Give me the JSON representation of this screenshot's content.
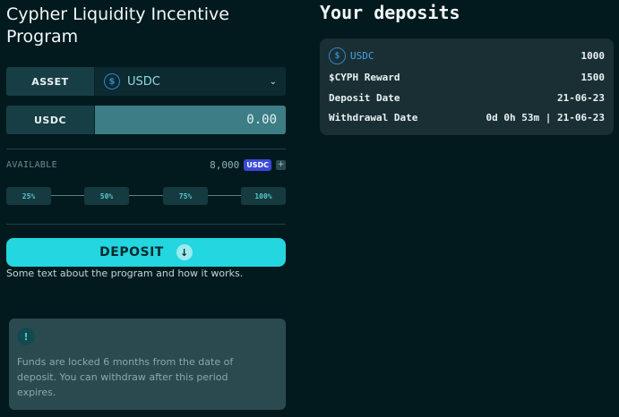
{
  "program": {
    "title": "Cypher Liquidity Incentive Program",
    "description": "Some text about the program and how it works."
  },
  "form": {
    "asset_label": "ASSET",
    "asset_value": "USDC",
    "amount_label": "USDC",
    "amount_value": "0.00",
    "available_label": "AVAILABLE",
    "available_value": "8,000",
    "available_unit": "USDC",
    "plus_symbol": "+",
    "percent_options": [
      "25%",
      "50%",
      "75%",
      "100%"
    ],
    "deposit_label": "DEPOSIT",
    "deposit_arrow": "↓"
  },
  "info": {
    "icon_symbol": "!",
    "text": "Funds are locked 6 months from the date of deposit. You can withdraw after this period expires."
  },
  "deposits": {
    "title": "Your deposits",
    "card": {
      "asset": "USDC",
      "amount": "1000",
      "reward_label": "$CYPH Reward",
      "reward_value": "1500",
      "deposit_date_label": "Deposit Date",
      "deposit_date_value": "21-06-23",
      "withdrawal_date_label": "Withdrawal Date",
      "withdrawal_date_value": "0d 0h 53m | 21-06-23"
    }
  },
  "icons": {
    "usdc": "usdc-coin-icon",
    "chevron": "chevron-down-icon",
    "info": "info-icon",
    "arrow": "arrow-down-icon"
  },
  "colors": {
    "background": "#021a1e",
    "accent": "#24d6e0",
    "badge": "#3b49d9",
    "usdc_blue": "#2f86c9"
  }
}
